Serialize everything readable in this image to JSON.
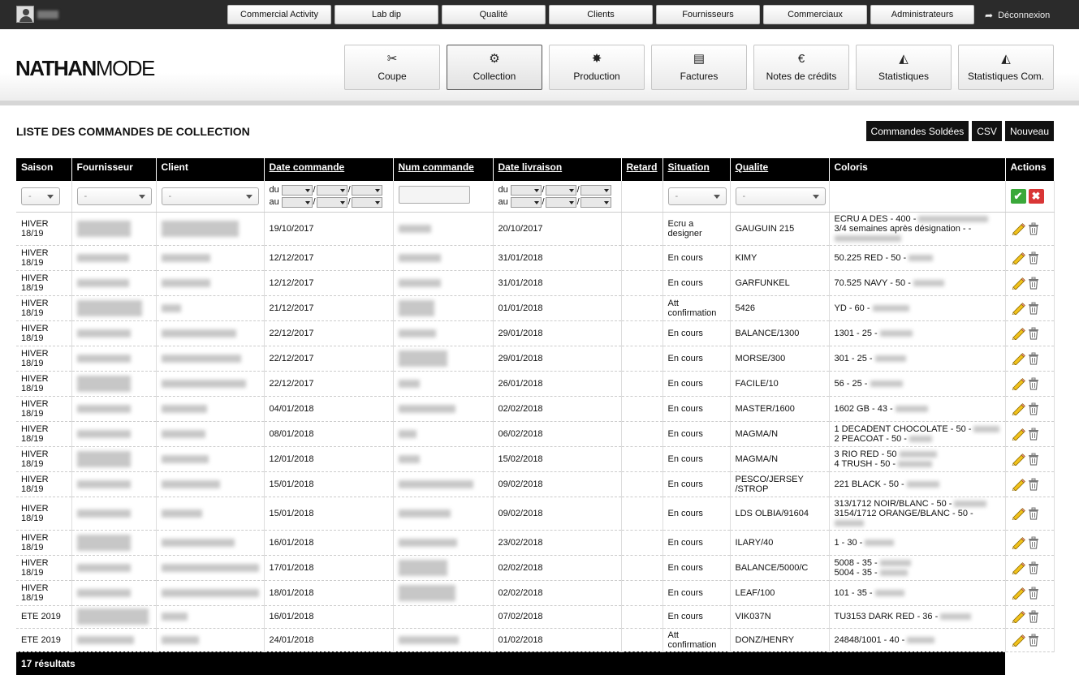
{
  "topnav": [
    "Commercial Activity",
    "Lab dip",
    "Qualité",
    "Clients",
    "Fournisseurs",
    "Commerciaux",
    "Administrateurs"
  ],
  "logout": "Déconnexion",
  "logo": {
    "bold": "NATHAN",
    "light": "MODE"
  },
  "modules": [
    {
      "label": "Coupe",
      "icon": "scissors-icon",
      "glyph": "✂"
    },
    {
      "label": "Collection",
      "icon": "gear-icon",
      "glyph": "⚙",
      "active": true
    },
    {
      "label": "Production",
      "icon": "sunburst-icon",
      "glyph": "✸"
    },
    {
      "label": "Factures",
      "icon": "invoice-icon",
      "glyph": "▤"
    },
    {
      "label": "Notes de crédits",
      "icon": "euro-icon",
      "glyph": "€"
    },
    {
      "label": "Statistiques",
      "icon": "area-chart-icon",
      "glyph": "◭"
    },
    {
      "label": "Statistiques Com.",
      "icon": "area-chart-icon",
      "glyph": "◭"
    }
  ],
  "page_title": "LISTE DES COMMANDES DE COLLECTION",
  "actions_top": [
    "Commandes Soldées",
    "CSV",
    "Nouveau"
  ],
  "columns": [
    "Saison",
    "Fournisseur",
    "Client",
    "Date commande",
    "Num commande",
    "Date livraison",
    "Retard",
    "Situation",
    "Qualite",
    "Coloris",
    "Actions"
  ],
  "filters": {
    "select_placeholder": "-",
    "du": "du",
    "au": "au",
    "sep": "/"
  },
  "rows": [
    {
      "saison": "HIVER 18/19",
      "date_commande": "19/10/2017",
      "date_livraison": "20/10/2017",
      "situation": "Ecru a designer",
      "qualite": "GAUGUIN 215",
      "coloris": [
        "ECRU A DES - 400 -",
        "3/4 semaines après désignation - -"
      ]
    },
    {
      "saison": "HIVER 18/19",
      "date_commande": "12/12/2017",
      "date_livraison": "31/01/2018",
      "situation": "En cours",
      "qualite": "KIMY",
      "coloris": [
        "50.225 RED - 50 -"
      ]
    },
    {
      "saison": "HIVER 18/19",
      "date_commande": "12/12/2017",
      "date_livraison": "31/01/2018",
      "situation": "En cours",
      "qualite": "GARFUNKEL",
      "coloris": [
        "70.525 NAVY - 50 -"
      ]
    },
    {
      "saison": "HIVER 18/19",
      "date_commande": "21/12/2017",
      "date_livraison": "01/01/2018",
      "situation": "Att confirmation",
      "qualite": "5426",
      "coloris": [
        "YD - 60 -"
      ]
    },
    {
      "saison": "HIVER 18/19",
      "date_commande": "22/12/2017",
      "date_livraison": "29/01/2018",
      "situation": "En cours",
      "qualite": "BALANCE/1300",
      "coloris": [
        "1301 - 25 -"
      ]
    },
    {
      "saison": "HIVER 18/19",
      "date_commande": "22/12/2017",
      "date_livraison": "29/01/2018",
      "situation": "En cours",
      "qualite": "MORSE/300",
      "coloris": [
        "301 - 25 -"
      ]
    },
    {
      "saison": "HIVER 18/19",
      "date_commande": "22/12/2017",
      "date_livraison": "26/01/2018",
      "situation": "En cours",
      "qualite": "FACILE/10",
      "coloris": [
        "56 - 25 -"
      ]
    },
    {
      "saison": "HIVER 18/19",
      "date_commande": "04/01/2018",
      "date_livraison": "02/02/2018",
      "situation": "En cours",
      "qualite": "MASTER/1600",
      "coloris": [
        "1602 GB - 43 -"
      ]
    },
    {
      "saison": "HIVER 18/19",
      "date_commande": "08/01/2018",
      "date_livraison": "06/02/2018",
      "situation": "En cours",
      "qualite": "MAGMA/N",
      "coloris": [
        "1 DECADENT CHOCOLATE - 50 -",
        "2 PEACOAT - 50 -"
      ]
    },
    {
      "saison": "HIVER 18/19",
      "date_commande": "12/01/2018",
      "date_livraison": "15/02/2018",
      "situation": "En cours",
      "qualite": "MAGMA/N",
      "coloris": [
        "3 RIO RED - 50",
        "4 TRUSH - 50 -"
      ]
    },
    {
      "saison": "HIVER 18/19",
      "date_commande": "15/01/2018",
      "date_livraison": "09/02/2018",
      "situation": "En cours",
      "qualite": "PESCO/JERSEY /STROP",
      "coloris": [
        "221 BLACK - 50 -"
      ]
    },
    {
      "saison": "HIVER 18/19",
      "date_commande": "15/01/2018",
      "date_livraison": "09/02/2018",
      "situation": "En cours",
      "qualite": "LDS OLBIA/91604",
      "coloris": [
        "313/1712 NOIR/BLANC - 50 -",
        "3154/1712 ORANGE/BLANC - 50 -"
      ]
    },
    {
      "saison": "HIVER 18/19",
      "date_commande": "16/01/2018",
      "date_livraison": "23/02/2018",
      "situation": "En cours",
      "qualite": "ILARY/40",
      "coloris": [
        "1 - 30 -"
      ]
    },
    {
      "saison": "HIVER 18/19",
      "date_commande": "17/01/2018",
      "date_livraison": "02/02/2018",
      "situation": "En cours",
      "qualite": "BALANCE/5000/C",
      "coloris": [
        "5008 - 35 -",
        "5004 - 35 -"
      ]
    },
    {
      "saison": "HIVER 18/19",
      "date_commande": "18/01/2018",
      "date_livraison": "02/02/2018",
      "situation": "En cours",
      "qualite": "LEAF/100",
      "coloris": [
        "101 - 35 -"
      ]
    },
    {
      "saison": "ETE 2019",
      "date_commande": "16/01/2018",
      "date_livraison": "07/02/2018",
      "situation": "En cours",
      "qualite": "VIK037N",
      "coloris": [
        "TU3153 DARK RED - 36 -"
      ]
    },
    {
      "saison": "ETE 2019",
      "date_commande": "24/01/2018",
      "date_livraison": "01/02/2018",
      "situation": "Att confirmation",
      "qualite": "DONZ/HENRY",
      "coloris": [
        "24848/1001 - 40 -"
      ]
    }
  ],
  "footer": "17 résultats"
}
